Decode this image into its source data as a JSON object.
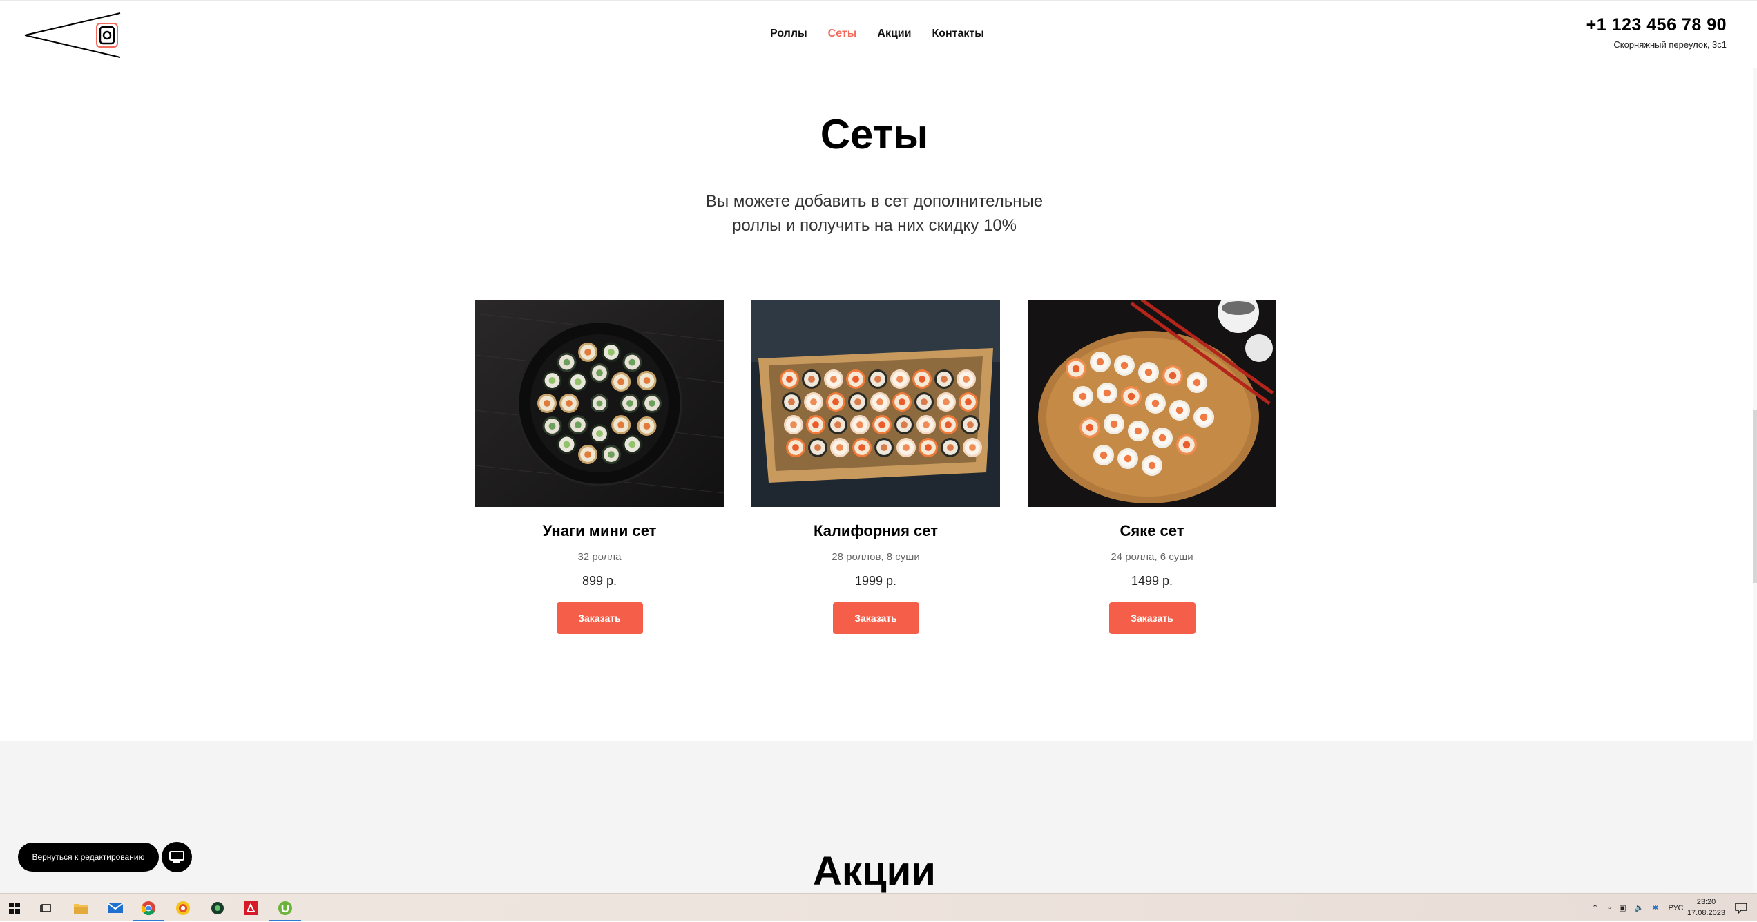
{
  "header": {
    "nav": [
      {
        "label": "Роллы",
        "active": false
      },
      {
        "label": "Сеты",
        "active": true
      },
      {
        "label": "Акции",
        "active": false
      },
      {
        "label": "Контакты",
        "active": false
      }
    ],
    "phone": "+1 123 456 78 90",
    "address": "Скорняжный переулок, 3с1"
  },
  "sets": {
    "title": "Сеты",
    "subtitle_line1": "Вы можете добавить в сет дополнительные",
    "subtitle_line2": "роллы и получить на них скидку 10%",
    "cards": [
      {
        "name": "Унаги мини сет",
        "desc": "32 ролла",
        "price": "899 р.",
        "button": "Заказать",
        "image": "round-black-plate-sushi"
      },
      {
        "name": "Калифорния сет",
        "desc": "28 роллов, 8 суши",
        "price": "1999 р.",
        "button": "Заказать",
        "image": "wooden-boat-sushi"
      },
      {
        "name": "Сяке сет",
        "desc": "24 ролла, 6 суши",
        "price": "1499 р.",
        "button": "Заказать",
        "image": "wooden-board-sushi"
      }
    ]
  },
  "promo": {
    "title": "Акции"
  },
  "editor": {
    "back_label": "Вернуться к редактированию",
    "device_icon": "monitor-icon"
  },
  "taskbar": {
    "lang": "РУС",
    "time": "23:20",
    "date": "17.08.2023",
    "apps": [
      "start-icon",
      "task-view-icon",
      "file-explorer-icon",
      "mail-icon",
      "chrome-icon",
      "yandex-browser-icon",
      "app-icon",
      "amd-icon",
      "utorrent-icon"
    ]
  },
  "colors": {
    "accent": "#f26b5b",
    "button": "#f55f49",
    "promo_bg": "#f4f4f4"
  }
}
